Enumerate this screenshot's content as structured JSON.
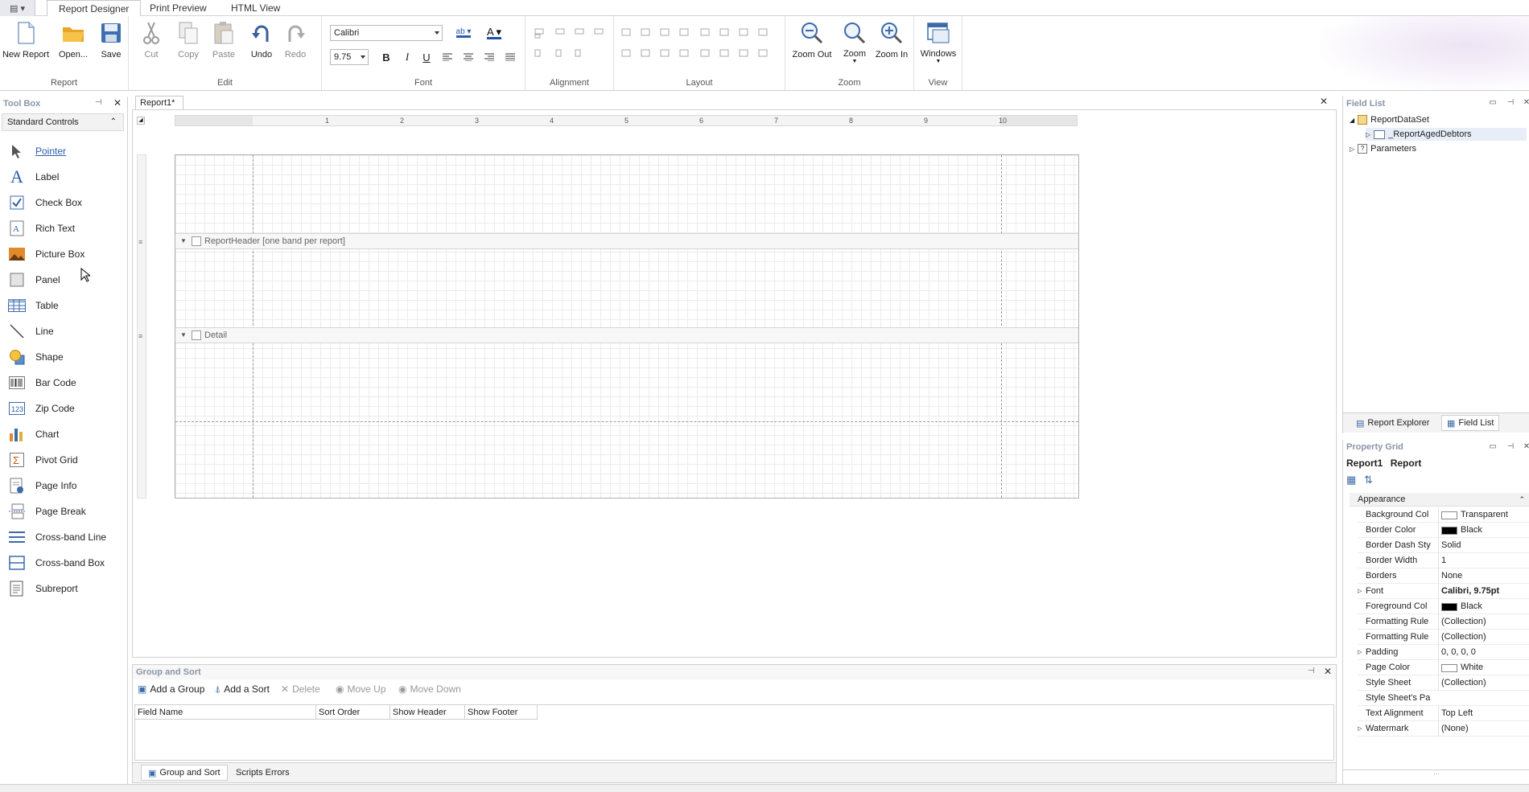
{
  "ribbon": {
    "tabs": [
      "Report Designer",
      "Print Preview",
      "HTML View"
    ],
    "groups": {
      "report": {
        "label": "Report",
        "new": "New Report",
        "open": "Open...",
        "save": "Save"
      },
      "edit": {
        "label": "Edit",
        "cut": "Cut",
        "copy": "Copy",
        "paste": "Paste",
        "undo": "Undo",
        "redo": "Redo"
      },
      "font": {
        "label": "Font",
        "family": "Calibri",
        "size": "9.75",
        "bold": "B",
        "italic": "I",
        "underline": "U"
      },
      "alignment": {
        "label": "Alignment"
      },
      "layout": {
        "label": "Layout"
      },
      "zoom": {
        "label": "Zoom",
        "out": "Zoom Out",
        "zoom": "Zoom",
        "in": "Zoom In"
      },
      "view": {
        "label": "View",
        "windows": "Windows"
      }
    }
  },
  "toolbox": {
    "title": "Tool Box",
    "category": "Standard Controls",
    "items": [
      "Pointer",
      "Label",
      "Check Box",
      "Rich Text",
      "Picture Box",
      "Panel",
      "Table",
      "Line",
      "Shape",
      "Bar Code",
      "Zip Code",
      "Chart",
      "Pivot Grid",
      "Page Info",
      "Page Break",
      "Cross-band Line",
      "Cross-band Box",
      "Subreport"
    ]
  },
  "designer": {
    "doc_tab": "Report1*",
    "ruler_numbers": [
      "1",
      "2",
      "3",
      "4",
      "5",
      "6",
      "7",
      "8",
      "9",
      "10"
    ],
    "bands": [
      "ReportHeader [one band per report]",
      "Detail"
    ]
  },
  "group_sort": {
    "title": "Group and Sort",
    "buttons": [
      "Add a Group",
      "Add a Sort",
      "Delete",
      "Move Up",
      "Move Down"
    ],
    "columns": [
      "Field Name",
      "Sort Order",
      "Show Header",
      "Show Footer"
    ],
    "bottom_tabs": [
      "Group and Sort",
      "Scripts Errors"
    ]
  },
  "field_list": {
    "title": "Field List",
    "tree": [
      "ReportDataSet",
      "_ReportAgedDebtors",
      "Parameters"
    ],
    "bottom_tabs": [
      "Report Explorer",
      "Field List"
    ]
  },
  "property_grid": {
    "title": "Property Grid",
    "object_name": "Report1",
    "object_type": "Report",
    "category": "Appearance",
    "rows": [
      {
        "name": "Background Col",
        "value": "Transparent",
        "swatch": "#ffffff"
      },
      {
        "name": "Border Color",
        "value": "Black",
        "swatch": "#000000"
      },
      {
        "name": "Border Dash Sty",
        "value": "Solid"
      },
      {
        "name": "Border Width",
        "value": "1"
      },
      {
        "name": "Borders",
        "value": "None"
      },
      {
        "name": "Font",
        "value": "Calibri, 9.75pt",
        "bold": true,
        "expand": true
      },
      {
        "name": "Foreground Col",
        "value": "Black",
        "swatch": "#000000"
      },
      {
        "name": "Formatting Rule",
        "value": "(Collection)"
      },
      {
        "name": "Formatting Rule",
        "value": "(Collection)"
      },
      {
        "name": "Padding",
        "value": "0, 0, 0, 0",
        "expand": true
      },
      {
        "name": "Page Color",
        "value": "White",
        "swatch": "#ffffff"
      },
      {
        "name": "Style Sheet",
        "value": "(Collection)"
      },
      {
        "name": "Style Sheet's Pa",
        "value": ""
      },
      {
        "name": "Text Alignment",
        "value": "Top Left"
      },
      {
        "name": "Watermark",
        "value": "(None)",
        "expand": true
      }
    ]
  }
}
